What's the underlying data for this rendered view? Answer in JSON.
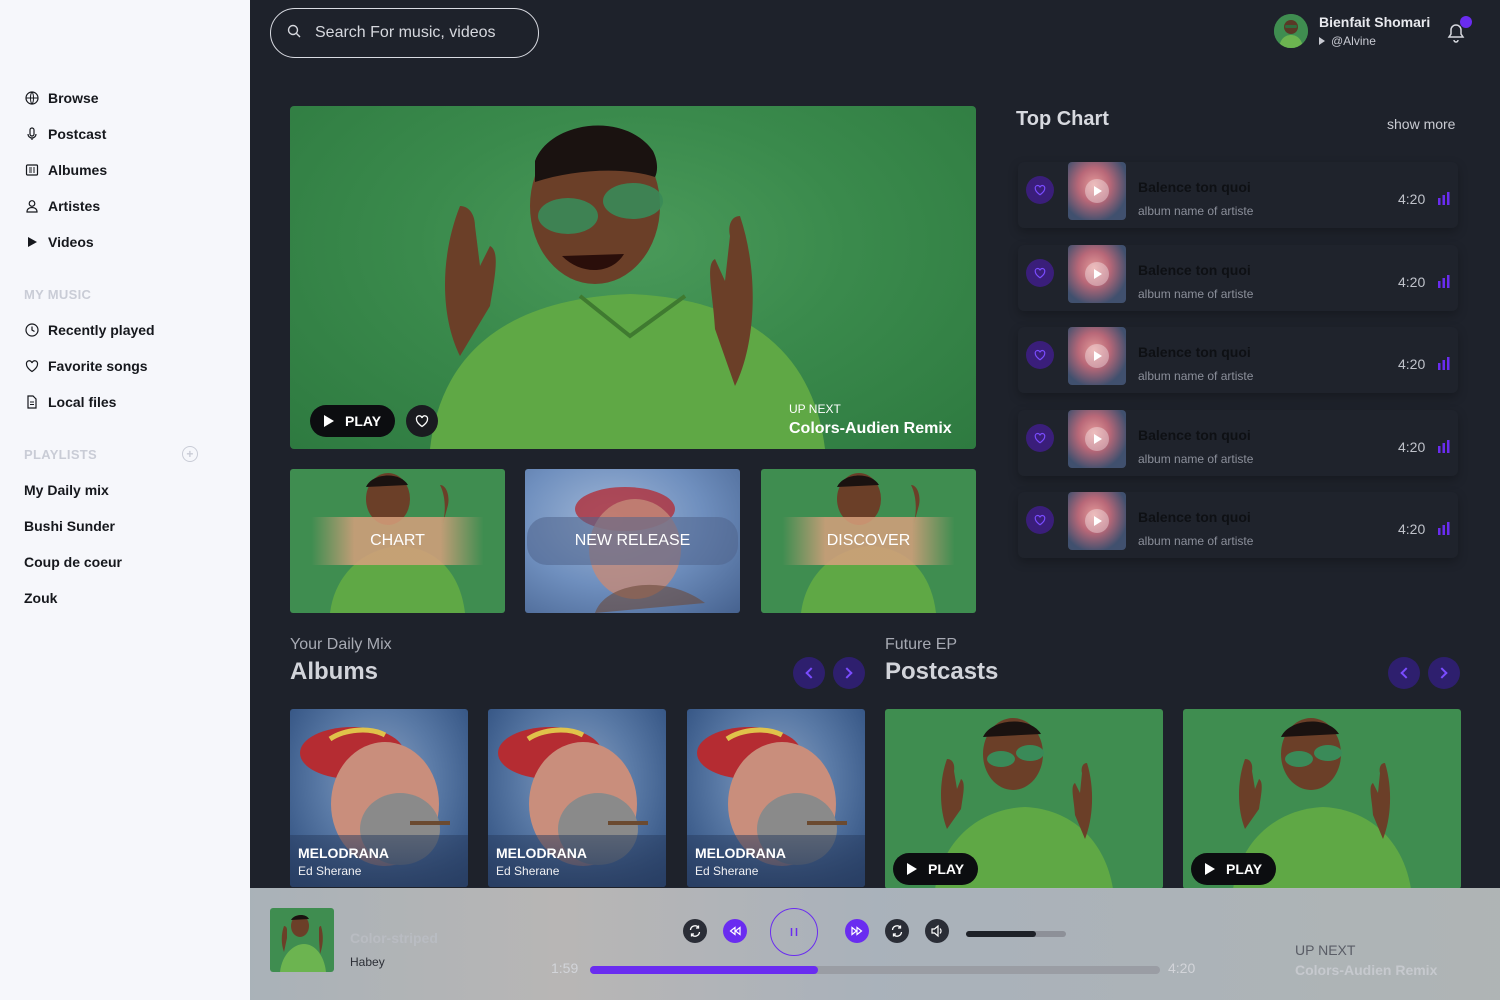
{
  "sidebar": {
    "nav": [
      {
        "label": "Browse",
        "icon": "globe-icon"
      },
      {
        "label": "Postcast",
        "icon": "microphone-icon"
      },
      {
        "label": "Albumes",
        "icon": "album-icon"
      },
      {
        "label": "Artistes",
        "icon": "user-icon"
      },
      {
        "label": "Videos",
        "icon": "play-icon"
      }
    ],
    "my_music_title": "MY MUSIC",
    "my_music": [
      {
        "label": "Recently played",
        "icon": "clock-icon"
      },
      {
        "label": "Favorite songs",
        "icon": "heart-icon"
      },
      {
        "label": "Local files",
        "icon": "file-icon"
      }
    ],
    "playlists_title": "PLAYLISTS",
    "playlists_add": "+",
    "playlists": [
      "My Daily mix",
      "Bushi Sunder",
      "Coup de coeur",
      "Zouk"
    ]
  },
  "search": {
    "placeholder": "Search For music, videos"
  },
  "user": {
    "name": "Bienfait Shomari",
    "handle": "@Alvine"
  },
  "hero": {
    "play_label": "PLAY",
    "upnext_label": "UP NEXT",
    "upnext_title": "Colors-Audien Remix"
  },
  "categories": [
    "CHART",
    "NEW RELEASE",
    "DISCOVER"
  ],
  "top_chart": {
    "title": "Top Chart",
    "show_more": "show more",
    "tracks": [
      {
        "title": "Balence ton quoi",
        "subtitle": "album name of artiste",
        "duration": "4:20"
      },
      {
        "title": "Balence ton quoi",
        "subtitle": "album name of artiste",
        "duration": "4:20"
      },
      {
        "title": "Balence ton quoi",
        "subtitle": "album name of artiste",
        "duration": "4:20"
      },
      {
        "title": "Balence ton quoi",
        "subtitle": "album name of artiste",
        "duration": "4:20"
      },
      {
        "title": "Balence ton quoi",
        "subtitle": "album name of artiste",
        "duration": "4:20"
      }
    ]
  },
  "albums_section": {
    "kicker": "Your Daily Mix",
    "title": "Albums",
    "items": [
      {
        "title": "MELODRANA",
        "artist": "Ed Sherane"
      },
      {
        "title": "MELODRANA",
        "artist": "Ed Sherane"
      },
      {
        "title": "MELODRANA",
        "artist": "Ed Sherane"
      }
    ]
  },
  "podcasts_section": {
    "kicker": "Future EP",
    "title": "Postcasts",
    "items": [
      {
        "play_label": "PLAY"
      },
      {
        "play_label": "PLAY"
      }
    ]
  },
  "player": {
    "title": "Color-striped",
    "artist": "Habey",
    "elapsed": "1:59",
    "total": "4:20",
    "progress": 0.4,
    "volume": 0.7,
    "upnext_label": "UP NEXT",
    "upnext_title": "Colors-Audien Remix"
  },
  "colors": {
    "accent": "#6a2cf0",
    "background": "#1e222b",
    "sidebar": "#f6f7fb",
    "green_photo": "#3f8d50"
  }
}
